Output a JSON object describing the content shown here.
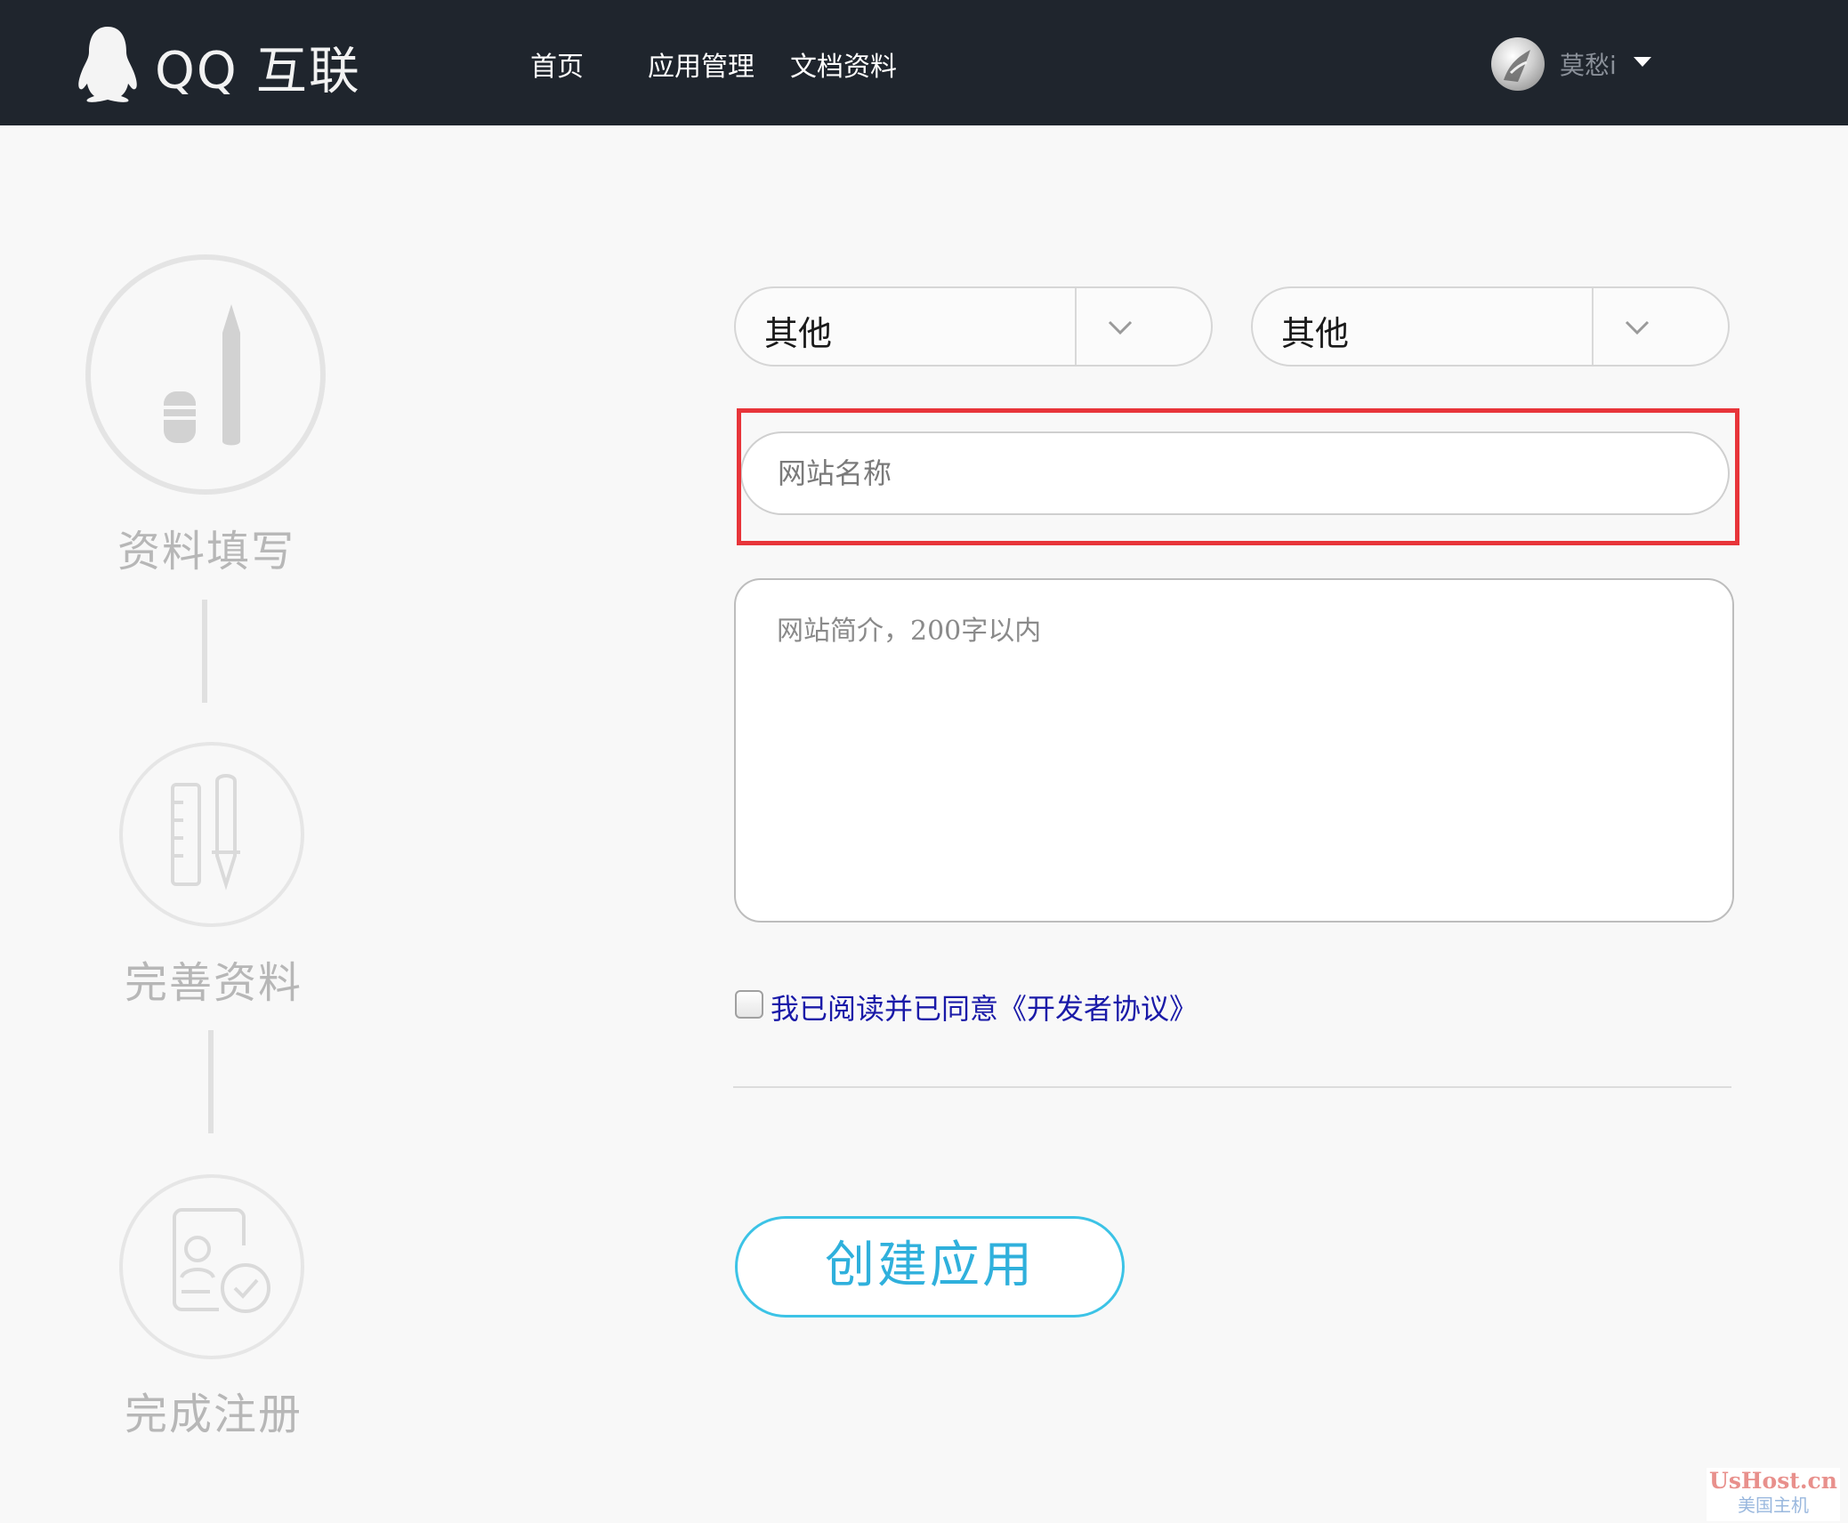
{
  "header": {
    "logo_text": "QQ 互联",
    "nav": {
      "home": "首页",
      "apps": "应用管理",
      "docs": "文档资料"
    },
    "user": {
      "name": "莫愁i"
    }
  },
  "steps": [
    {
      "label": "资料填写",
      "state": "active"
    },
    {
      "label": "完善资料",
      "state": "pending"
    },
    {
      "label": "完成注册",
      "state": "pending"
    }
  ],
  "form": {
    "category_primary": "其他",
    "category_secondary": "其他",
    "site_name_placeholder": "网站名称",
    "site_name_value": "",
    "site_desc_placeholder": "网站简介，200字以内",
    "agreement_checked": false,
    "agreement_label": "我已阅读并已同意《开发者协议》",
    "submit_label": "创建应用"
  },
  "watermark": {
    "top": "UsHost.cn",
    "bottom": "美国主机"
  },
  "colors": {
    "topbar": "#1f252d",
    "highlight": "#e8353a",
    "accent": "#2fb0dc",
    "link": "#1a1aa8"
  }
}
